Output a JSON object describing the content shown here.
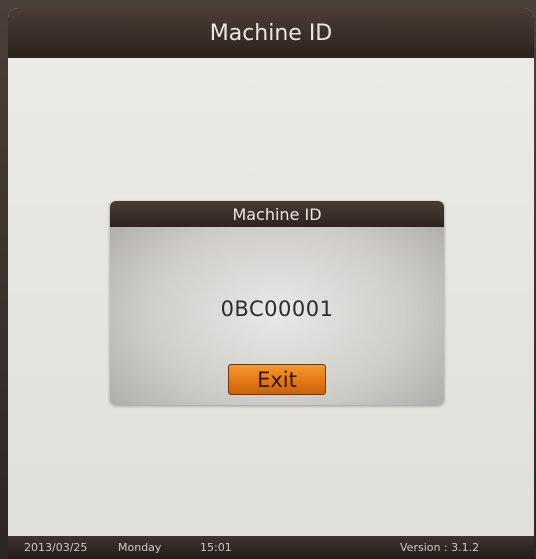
{
  "header": {
    "title": "Machine ID"
  },
  "dialog": {
    "title": "Machine ID",
    "machine_id": "0BC00001",
    "exit_label": "Exit"
  },
  "status_bar": {
    "date": "2013/03/25",
    "day": "Monday",
    "time": "15:01",
    "version": "Version : 3.1.2"
  },
  "colors": {
    "title_bar": "#2b221e",
    "screen_background": "#e6e4df",
    "exit_button": "#e57814"
  }
}
